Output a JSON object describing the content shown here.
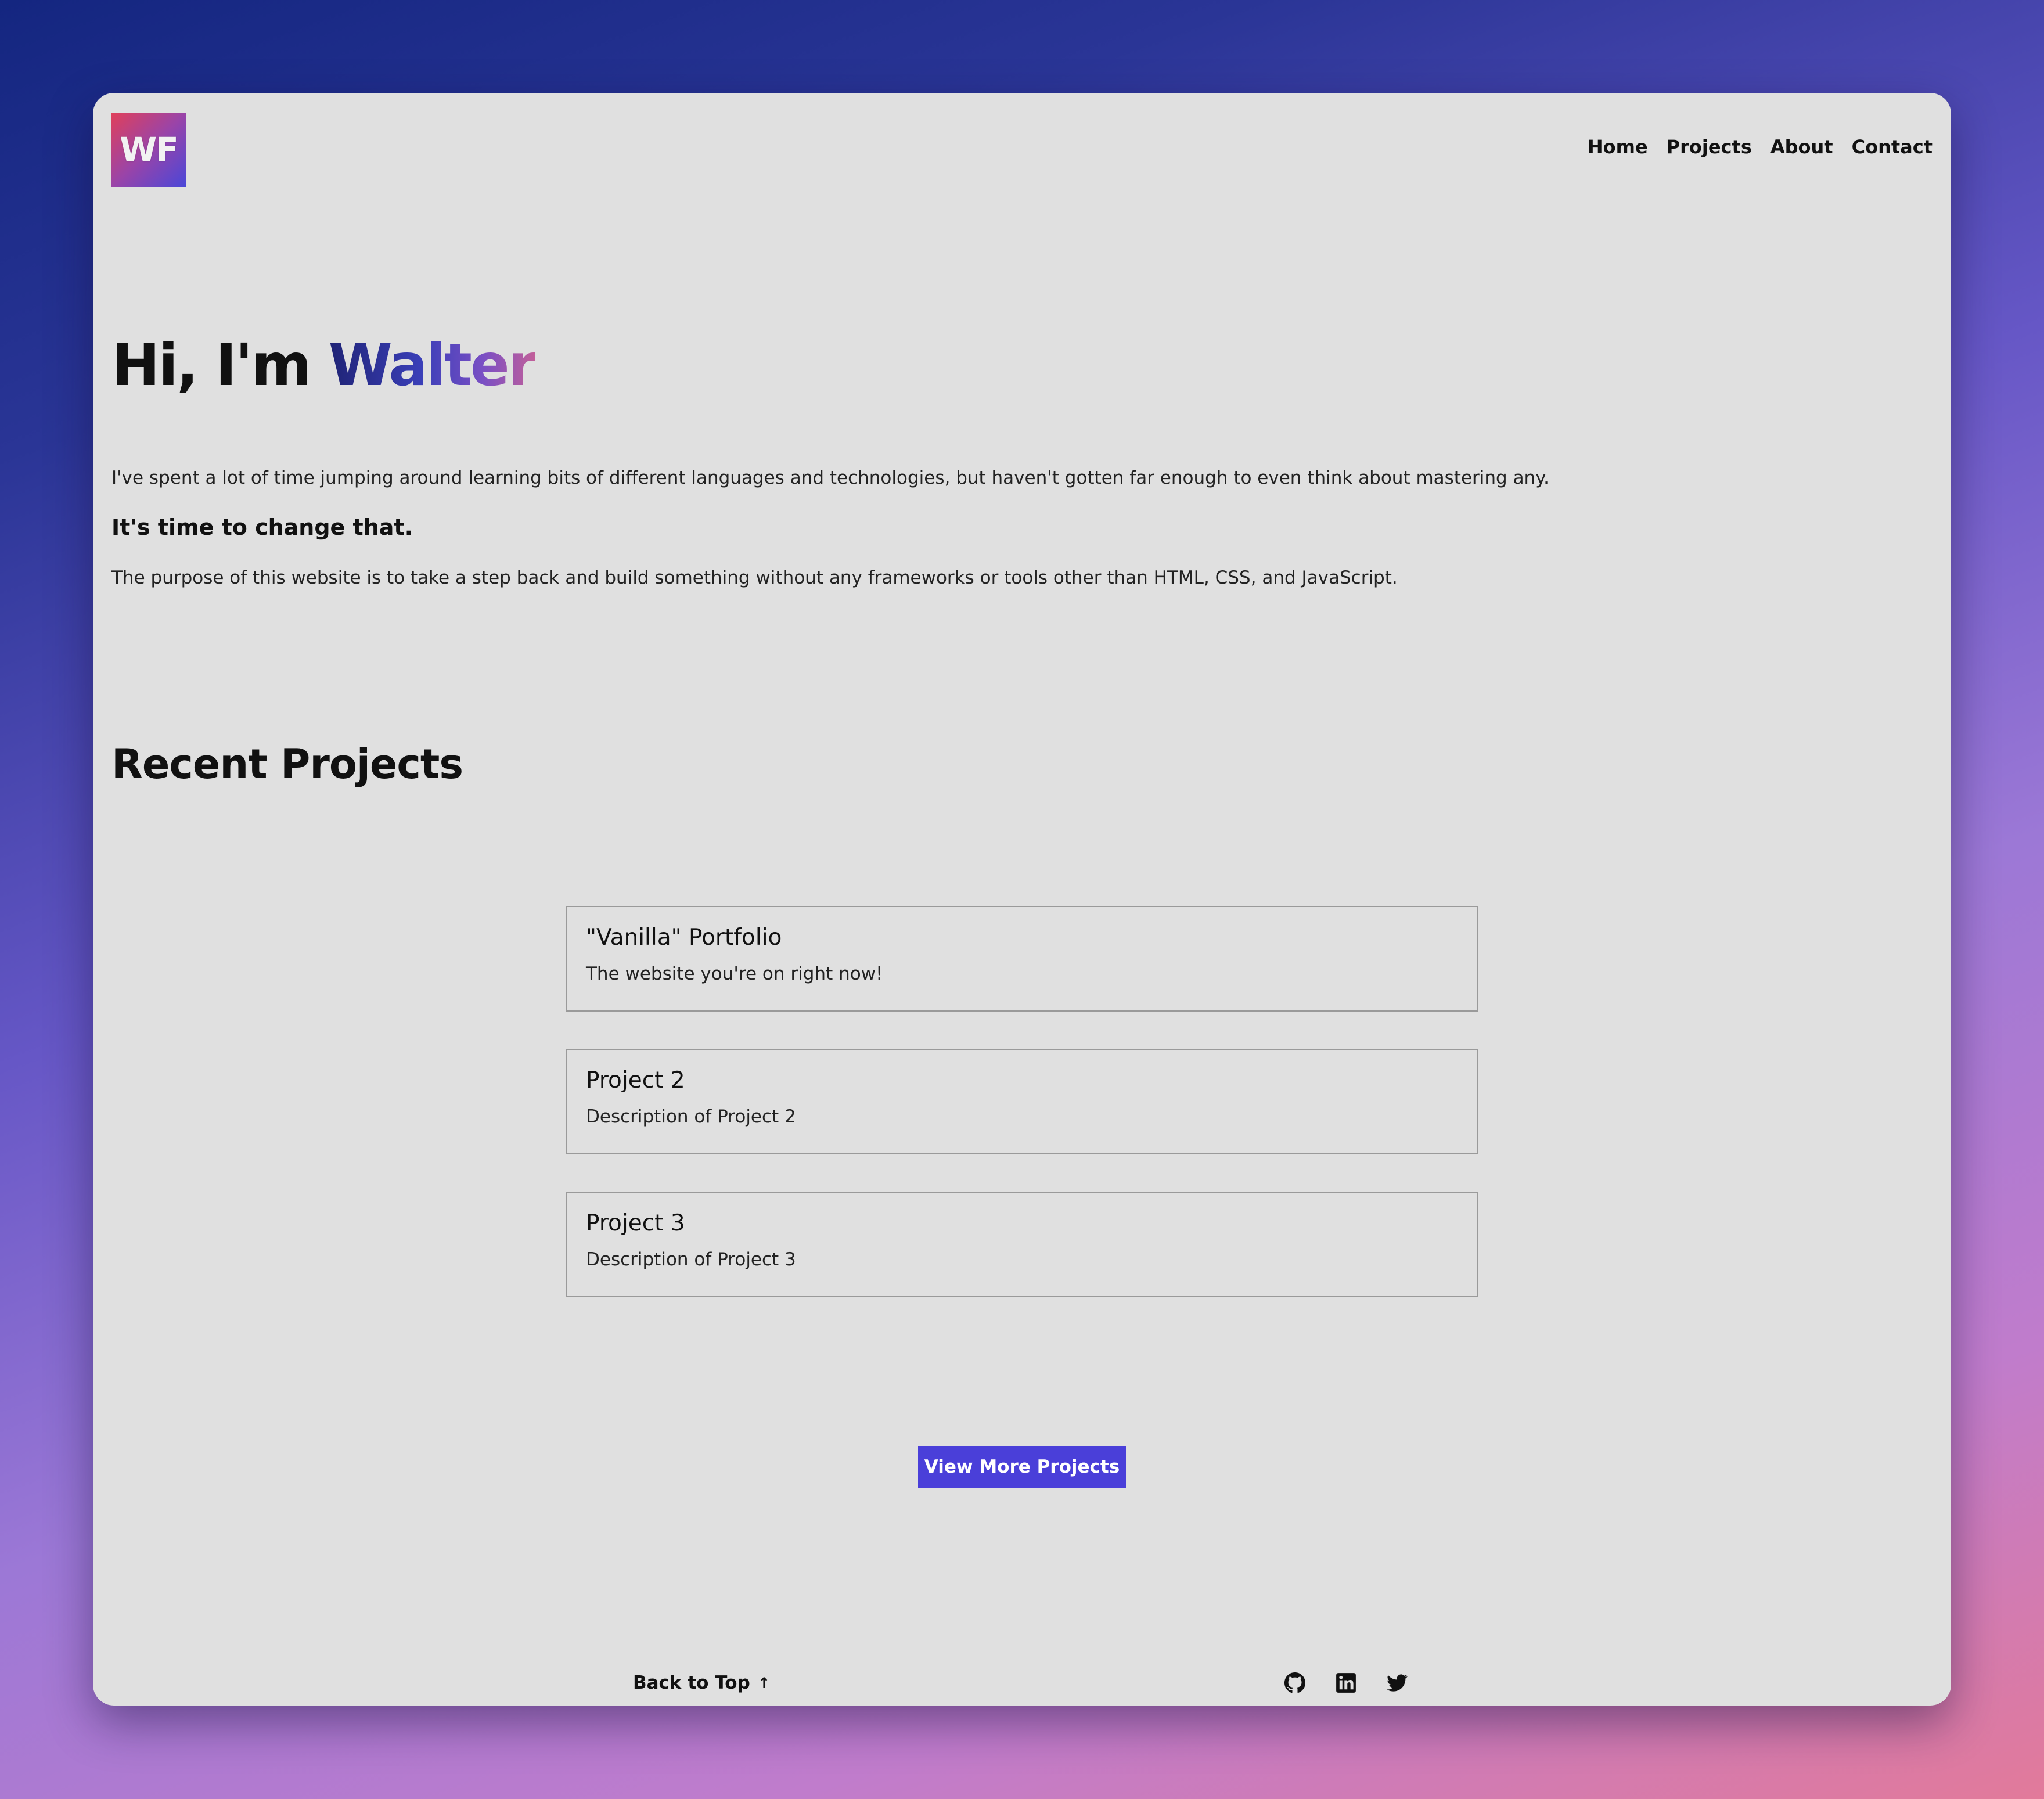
{
  "header": {
    "logo_text": "WF",
    "nav": [
      {
        "label": "Home"
      },
      {
        "label": "Projects"
      },
      {
        "label": "About"
      },
      {
        "label": "Contact"
      }
    ]
  },
  "hero": {
    "greeting": "Hi, I'm ",
    "name": "Walter",
    "intro": "I've spent a lot of time jumping around learning bits of different languages and technologies, but haven't gotten far enough to even think about mastering any.",
    "change": "It's time to change that.",
    "purpose": "The purpose of this website is to take a step back and build something without any frameworks or tools other than HTML, CSS, and JavaScript."
  },
  "projects": {
    "title": "Recent Projects",
    "items": [
      {
        "title": "\"Vanilla\" Portfolio",
        "description": "The website you're on right now!"
      },
      {
        "title": "Project 2",
        "description": "Description of Project 2"
      },
      {
        "title": "Project 3",
        "description": "Description of Project 3"
      }
    ],
    "more_label": "View More Projects"
  },
  "footer": {
    "back_to_top": "Back to Top",
    "back_arrow": "↑",
    "socials": [
      "github-icon",
      "linkedin-icon",
      "twitter-icon"
    ]
  },
  "colors": {
    "accent": "#4a3fd9",
    "panel": "#e0e0e0"
  }
}
